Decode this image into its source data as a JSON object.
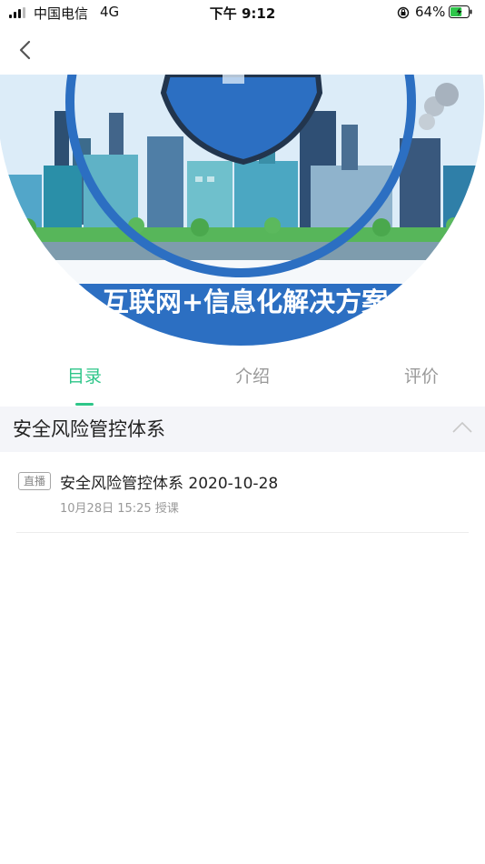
{
  "status_bar": {
    "carrier": "中国电信",
    "network": "4G",
    "time": "下午 9:12",
    "battery": "64%",
    "battery_level": 0.64
  },
  "nav": {
    "back_icon": "chevron-left-icon"
  },
  "banner": {
    "caption": "互联网+信息化解决方案"
  },
  "tabs": [
    {
      "label": "目录",
      "active": true
    },
    {
      "label": "介绍",
      "active": false
    },
    {
      "label": "评价",
      "active": false
    }
  ],
  "section": {
    "title": "安全风险管控体系",
    "toggle_icon": "chevron-up-icon"
  },
  "lessons": [
    {
      "badge": "直播",
      "title": "安全风险管控体系 2020-10-28",
      "meta": "10月28日 15:25 授课"
    }
  ],
  "colors": {
    "accent": "#2ec689",
    "section_bg": "#f4f5f9",
    "banner_blue": "#2c6fc2"
  }
}
